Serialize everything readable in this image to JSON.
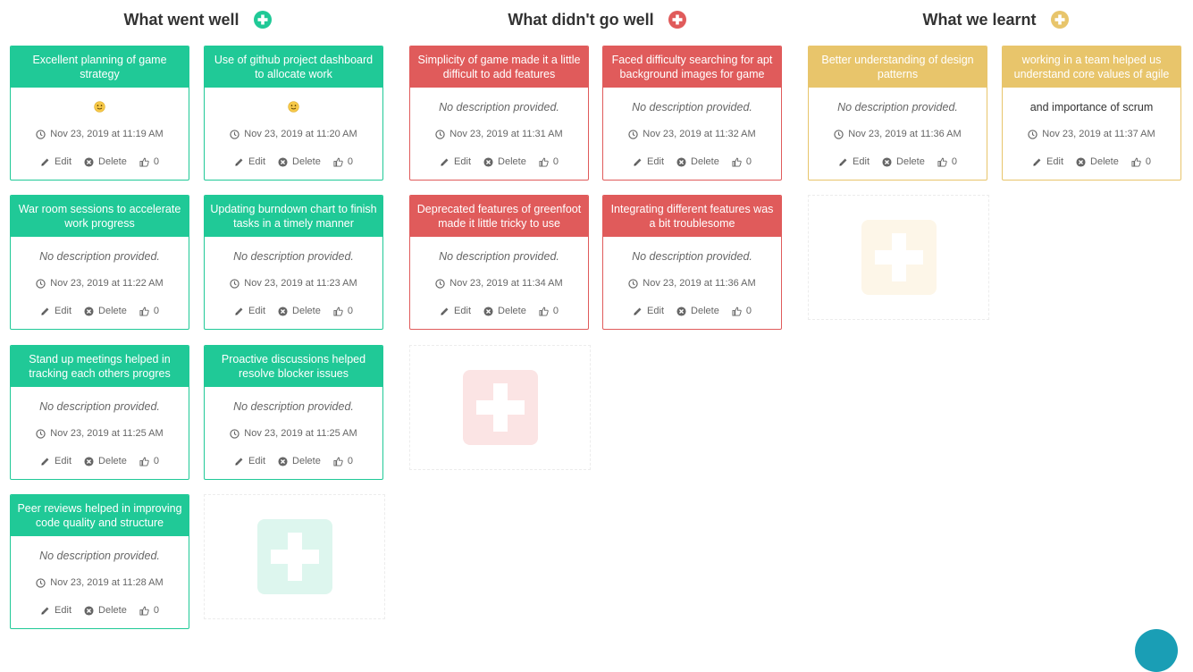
{
  "colors": {
    "good": "#20c997",
    "bad": "#e05b5b",
    "learnt": "#e8c56b",
    "good_placeholder": "#ddf6ee",
    "bad_placeholder": "#fbe4e4",
    "learnt_placeholder": "#fdf6e8",
    "fab": "#1a9eb5"
  },
  "columns": {
    "well": {
      "title": "What went well",
      "cards": [
        {
          "title": "Excellent planning of game strategy",
          "emoji": "🙂",
          "date": "Nov 23, 2019 at 11:19 AM",
          "edit": "Edit",
          "delete": "Delete",
          "likes": "0"
        },
        {
          "title": "Use of github project dashboard to allocate work",
          "emoji": "🙂",
          "date": "Nov 23, 2019 at 11:20 AM",
          "edit": "Edit",
          "delete": "Delete",
          "likes": "0"
        },
        {
          "title": "War room sessions to accelerate work progress",
          "description": "No description provided.",
          "date": "Nov 23, 2019 at 11:22 AM",
          "edit": "Edit",
          "delete": "Delete",
          "likes": "0"
        },
        {
          "title": "Updating burndown chart to finish tasks in a timely manner",
          "description": "No description provided.",
          "date": "Nov 23, 2019 at 11:23 AM",
          "edit": "Edit",
          "delete": "Delete",
          "likes": "0"
        },
        {
          "title": "Stand up meetings helped in tracking each others progres",
          "description": "No description provided.",
          "date": "Nov 23, 2019 at 11:25 AM",
          "edit": "Edit",
          "delete": "Delete",
          "likes": "0"
        },
        {
          "title": "Proactive discussions helped resolve blocker issues",
          "description": "No description provided.",
          "date": "Nov 23, 2019 at 11:25 AM",
          "edit": "Edit",
          "delete": "Delete",
          "likes": "0"
        },
        {
          "title": "Peer reviews helped in improving code quality and structure",
          "description": "No description provided.",
          "date": "Nov 23, 2019 at 11:28 AM",
          "edit": "Edit",
          "delete": "Delete",
          "likes": "0"
        }
      ]
    },
    "not_well": {
      "title": "What didn't go well",
      "cards": [
        {
          "title": "Simplicity of game made it a little difficult to add features",
          "description": "No description provided.",
          "date": "Nov 23, 2019 at 11:31 AM",
          "edit": "Edit",
          "delete": "Delete",
          "likes": "0"
        },
        {
          "title": "Faced difficulty searching for apt background images for game",
          "description": "No description provided.",
          "date": "Nov 23, 2019 at 11:32 AM",
          "edit": "Edit",
          "delete": "Delete",
          "likes": "0"
        },
        {
          "title": "Deprecated features of greenfoot made it little tricky to use",
          "description": "No description provided.",
          "date": "Nov 23, 2019 at 11:34 AM",
          "edit": "Edit",
          "delete": "Delete",
          "likes": "0"
        },
        {
          "title": "Integrating different features was a bit troublesome",
          "description": "No description provided.",
          "date": "Nov 23, 2019 at 11:36 AM",
          "edit": "Edit",
          "delete": "Delete",
          "likes": "0"
        }
      ]
    },
    "learnt": {
      "title": "What we learnt",
      "cards": [
        {
          "title": "Better understanding of design patterns",
          "description": "No description provided.",
          "date": "Nov 23, 2019 at 11:36 AM",
          "edit": "Edit",
          "delete": "Delete",
          "likes": "0"
        },
        {
          "title": "working in a team helped us understand core values of agile",
          "description_plain": "and importance of scrum",
          "date": "Nov 23, 2019 at 11:37 AM",
          "edit": "Edit",
          "delete": "Delete",
          "likes": "0"
        }
      ]
    }
  },
  "icons": {
    "add": "plus-circle-icon",
    "clock": "clock-icon",
    "edit": "pencil-icon",
    "delete": "times-circle-icon",
    "like": "thumbs-up-icon",
    "placeholder_add": "plus-icon"
  }
}
